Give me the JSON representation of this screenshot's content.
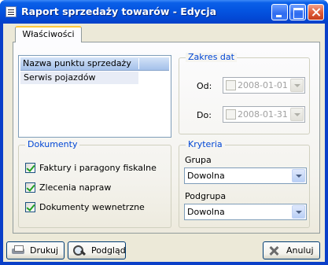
{
  "window": {
    "title": "Raport sprzedaży towarów - Edycja",
    "icons": [
      "app-icon",
      "minimize-icon",
      "maximize-icon",
      "close-icon"
    ]
  },
  "tabs": [
    {
      "label": "Właściwości",
      "selected": true
    }
  ],
  "sales_points": {
    "header": "Nazwa punktu sprzedaży",
    "rows": [
      "Serwis pojazdów"
    ]
  },
  "date_range": {
    "legend": "Zakres dat",
    "from_label": "Od:",
    "from_value": "2008-01-01",
    "to_label": "Do:",
    "to_value": "2008-01-31"
  },
  "documents": {
    "legend": "Dokumenty",
    "items": [
      {
        "label": "Faktury i paragony fiskalne",
        "checked": true
      },
      {
        "label": "Zlecenia napraw",
        "checked": true
      },
      {
        "label": "Dokumenty wewnetrzne",
        "checked": true
      }
    ]
  },
  "criteria": {
    "legend": "Kryteria",
    "group_label": "Grupa",
    "group_value": "Dowolna",
    "subgroup_label": "Podgrupa",
    "subgroup_value": "Dowolna"
  },
  "buttons": {
    "print": "Drukuj",
    "preview": "Podgląd",
    "cancel": "Anuluj"
  },
  "colors": {
    "titlebar": "#0454e0",
    "legend_text": "#0046d5",
    "face": "#ece9d8",
    "check_mark": "#21a121"
  }
}
